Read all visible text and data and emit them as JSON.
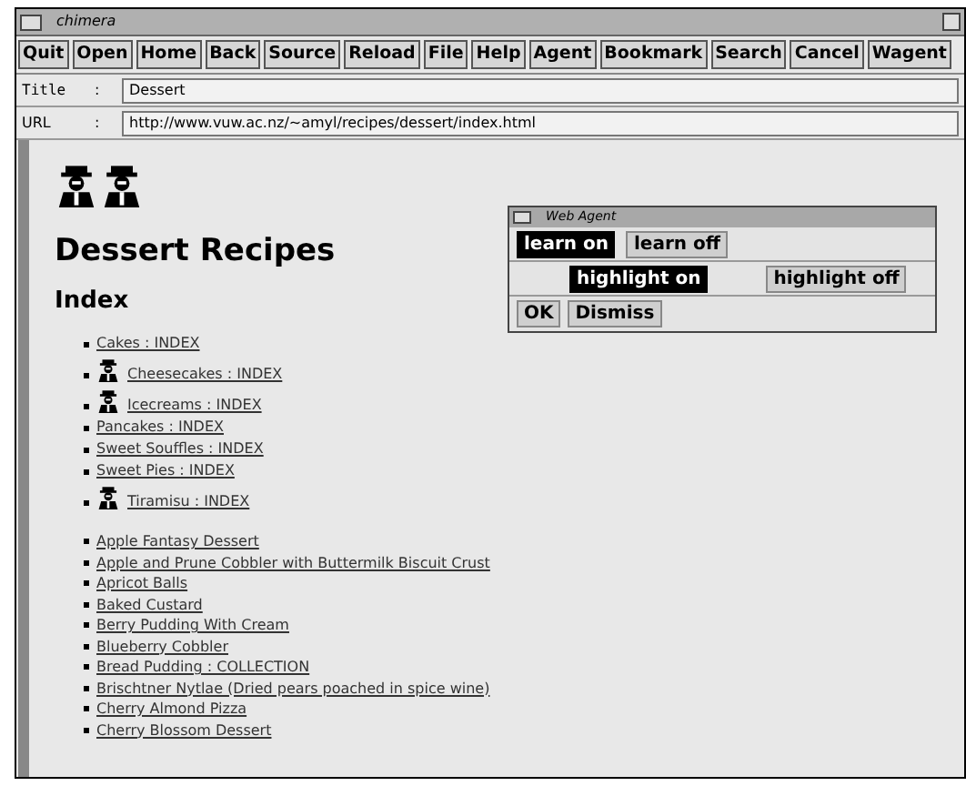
{
  "window": {
    "title": "chimera"
  },
  "toolbar": [
    "Quit",
    "Open",
    "Home",
    "Back",
    "Source",
    "Reload",
    "File",
    "Help",
    "Agent",
    "Bookmark",
    "Search",
    "Cancel",
    "Wagent"
  ],
  "fields": [
    {
      "label": "Title",
      "separator": ":",
      "value": "Dessert"
    },
    {
      "label": "URL",
      "separator": ":",
      "value": "http://www.vuw.ac.nz/~amyl/recipes/dessert/index.html"
    }
  ],
  "page": {
    "heading": "Dessert Recipes",
    "subheading": "Index",
    "index_items": [
      {
        "text": "Cakes : INDEX",
        "kind": "plain"
      },
      {
        "text": "Cheesecakes : INDEX",
        "kind": "icon"
      },
      {
        "text": "Icecreams : INDEX",
        "kind": "icon"
      },
      {
        "text": "Pancakes : INDEX",
        "kind": "plain"
      },
      {
        "text": "Sweet Souffles : INDEX",
        "kind": "plain"
      },
      {
        "text": "Sweet Pies : INDEX",
        "kind": "plain"
      },
      {
        "text": "Tiramisu : INDEX",
        "kind": "icon"
      }
    ],
    "recipes": [
      "Apple Fantasy Dessert",
      "Apple and Prune Cobbler with Buttermilk Biscuit Crust",
      "Apricot Balls",
      "Baked Custard",
      "Berry Pudding With Cream",
      "Blueberry Cobbler",
      "Bread Pudding : COLLECTION",
      "Brischtner Nytlae (Dried pears poached in spice wine)",
      "Cherry Almond Pizza",
      "Cherry Blossom Dessert"
    ]
  },
  "dialog": {
    "title": "Web Agent",
    "learn_toggles": [
      {
        "label": "learn on",
        "selected": true
      },
      {
        "label": "learn off",
        "selected": false
      }
    ],
    "highlight_toggles": [
      {
        "label": "highlight on",
        "selected": true
      },
      {
        "label": "highlight off",
        "selected": false
      }
    ],
    "buttons": [
      "OK",
      "Dismiss"
    ]
  }
}
